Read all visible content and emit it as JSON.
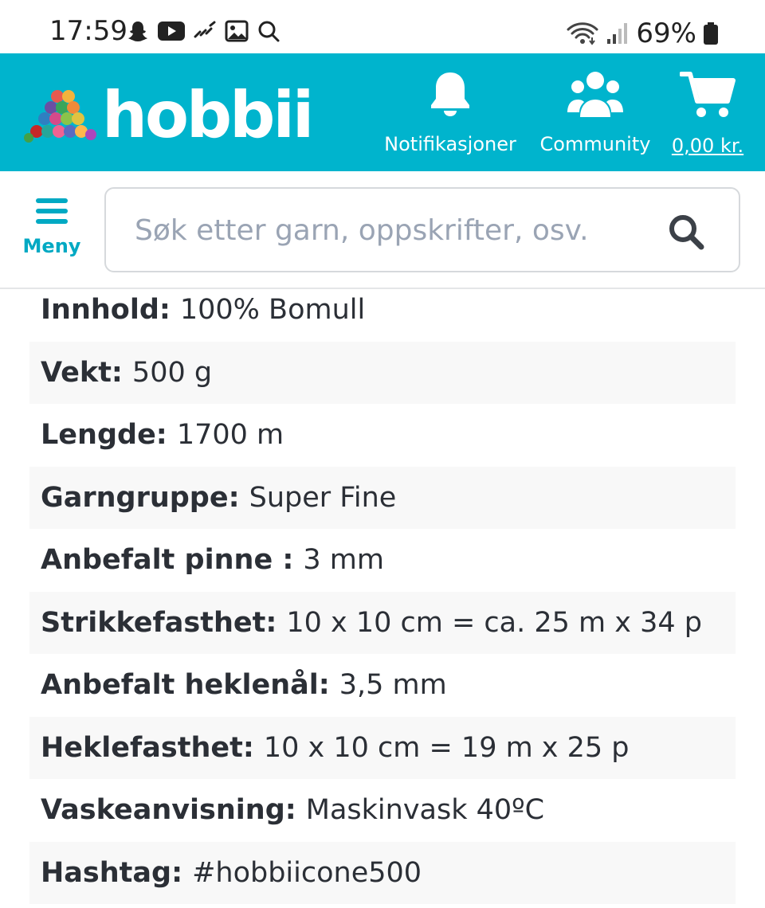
{
  "status_bar": {
    "time": "17:59",
    "left_icons": [
      "snapchat-icon",
      "youtube-icon",
      "missed-call-icon",
      "gallery-icon",
      "search-icon"
    ],
    "right_icons": [
      "wifi-icon",
      "signal-icon"
    ],
    "battery_percent": "69%"
  },
  "header": {
    "brand": "hobbii",
    "background_color": "#00b4cd",
    "notifications_label": "Notifikasjoner",
    "community_label": "Community",
    "cart_total": "0,00 kr."
  },
  "search": {
    "menu_label": "Meny",
    "placeholder": "Søk etter garn, oppskrifter, osv.",
    "value": ""
  },
  "specs": [
    {
      "label": "Innhold:",
      "value": "100% Bomull"
    },
    {
      "label": "Vekt:",
      "value": "500 g"
    },
    {
      "label": "Lengde:",
      "value": "1700 m"
    },
    {
      "label": "Garngruppe:",
      "value": "Super Fine"
    },
    {
      "label": "Anbefalt pinne :",
      "value": "3 mm"
    },
    {
      "label": "Strikkefasthet:",
      "value": "10 x 10 cm = ca. 25 m x 34 p"
    },
    {
      "label": "Anbefalt heklenål:",
      "value": "3,5 mm"
    },
    {
      "label": "Heklefasthet:",
      "value": "10 x 10 cm = 19 m x 25 p"
    },
    {
      "label": "Vaskeanvisning:",
      "value": "Maskinvask 40ºC"
    },
    {
      "label": "Hashtag:",
      "value": "#hobbiicone500"
    }
  ]
}
